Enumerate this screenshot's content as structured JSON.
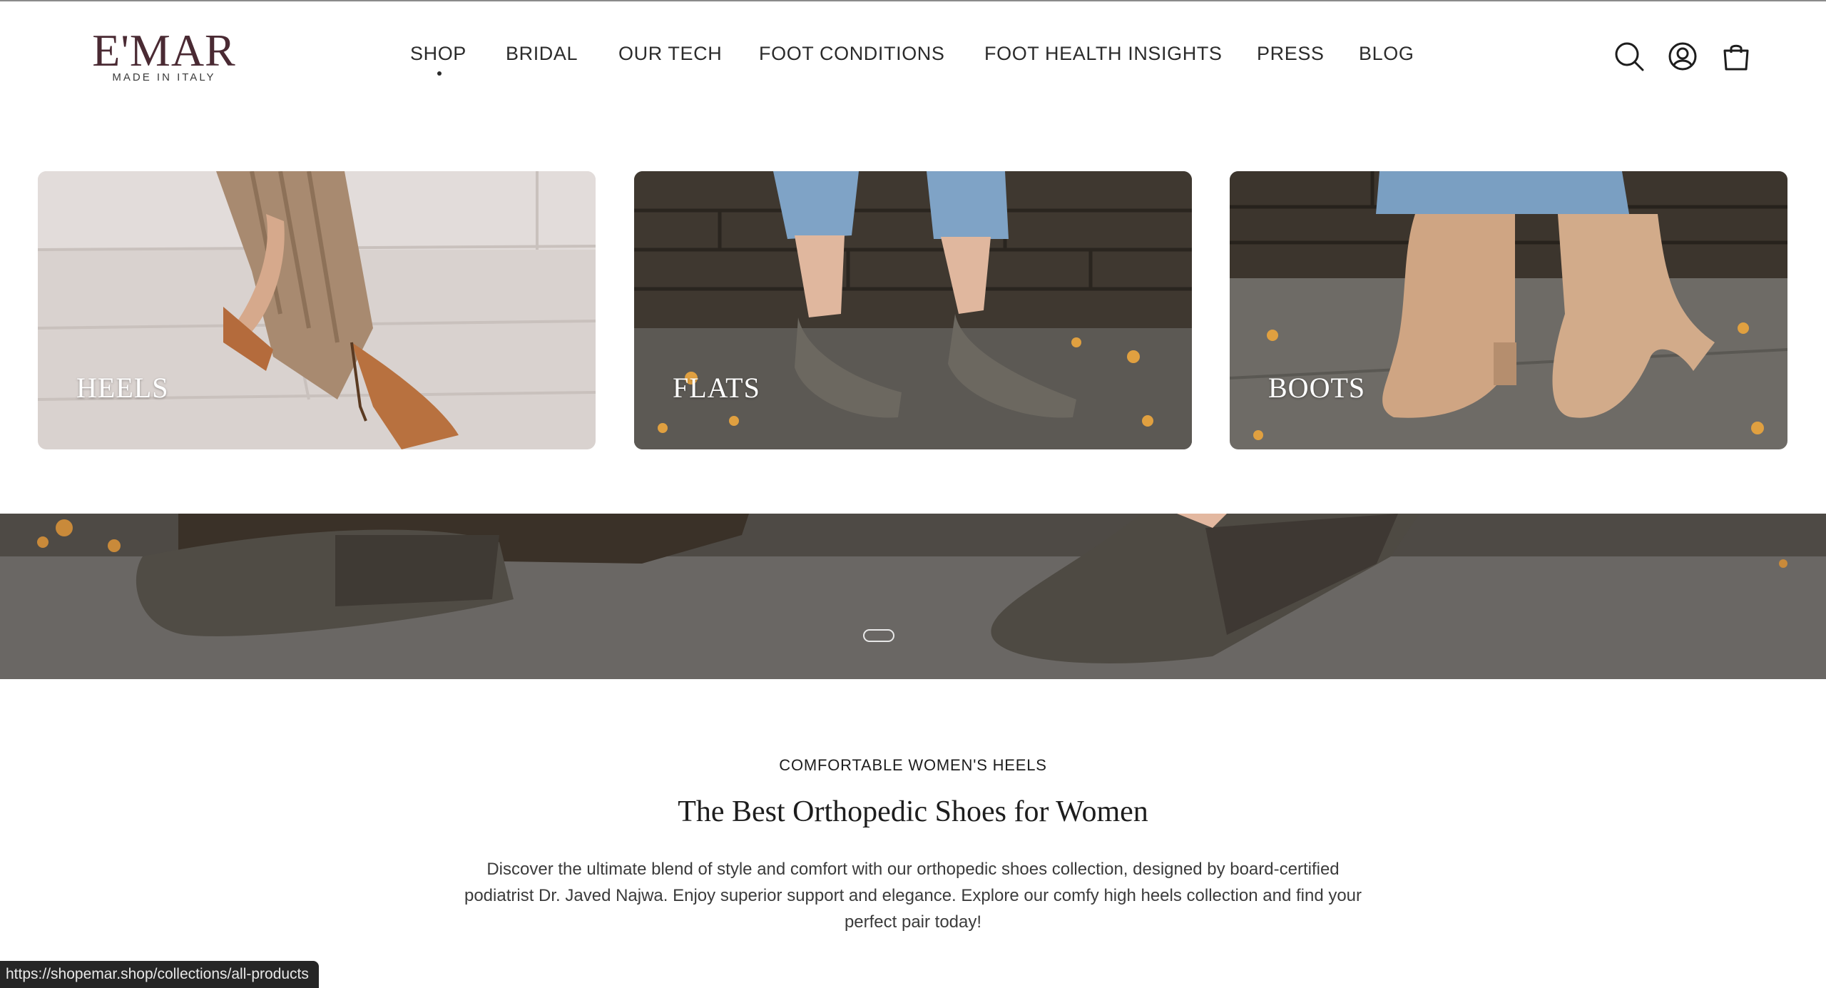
{
  "header": {
    "logo_text": "E'MAR",
    "logo_subtitle": "MADE IN ITALY",
    "nav": [
      {
        "label": "SHOP",
        "active": true
      },
      {
        "label": "BRIDAL"
      },
      {
        "label": "OUR TECH"
      },
      {
        "label": "FOOT CONDITIONS"
      },
      {
        "label": "FOOT HEALTH INSIGHTS"
      },
      {
        "label": "PRESS"
      },
      {
        "label": "BLOG"
      }
    ],
    "icons": [
      "search-icon",
      "account-icon",
      "cart-icon"
    ]
  },
  "categories": [
    {
      "label": "HEELS"
    },
    {
      "label": "FLATS"
    },
    {
      "label": "BOOTS"
    }
  ],
  "section": {
    "eyebrow": "COMFORTABLE WOMEN'S HEELS",
    "title": "The Best Orthopedic Shoes for Women",
    "description": "Discover the ultimate blend of style and comfort with our orthopedic shoes collection, designed by board-certified podiatrist Dr. Javed Najwa. Enjoy superior support and elegance. Explore our comfy high heels collection and find your perfect pair today!"
  },
  "status_url": "https://shopemar.shop/collections/all-products",
  "colors": {
    "brand": "#4a2a33",
    "text": "#1d1d1d",
    "statusbar": "#262626"
  }
}
